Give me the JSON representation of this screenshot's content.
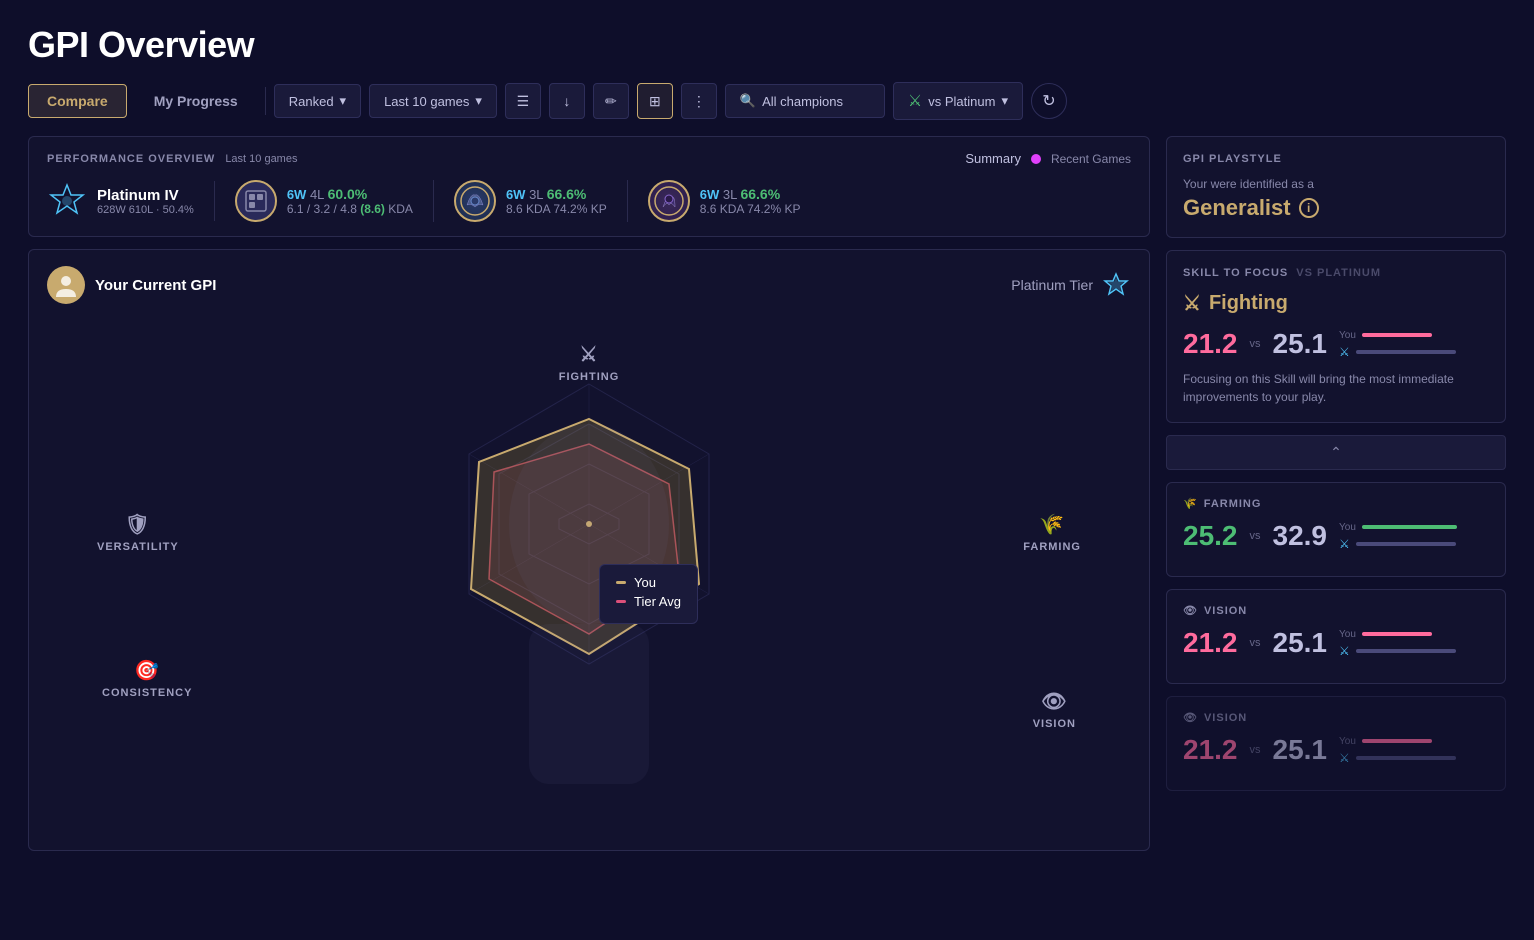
{
  "page": {
    "title": "GPI Overview"
  },
  "toolbar": {
    "compare_label": "Compare",
    "my_progress_label": "My Progress",
    "ranked_label": "Ranked",
    "last_10_label": "Last 10 games",
    "all_champions_label": "All champions",
    "vs_platinum_label": "vs Platinum"
  },
  "performance_overview": {
    "title": "PERFORMANCE OVERVIEW",
    "subtitle": "Last 10 games",
    "summary_label": "Summary",
    "recent_games_label": "Recent Games",
    "rank": {
      "name": "Platinum IV",
      "lp_info": "628W 610L · 50.4%"
    },
    "stat1": {
      "wins": "6W",
      "losses": "4L",
      "win_rate": "60.0%",
      "kda": "6.1 / 3.2 / 4.8",
      "kda_highlight": "(8.6)",
      "kda_label": "KDA"
    },
    "champ1": {
      "wins": "6W",
      "losses": "3L",
      "win_rate": "66.6%",
      "kda_val": "8.6",
      "kda_label": "KDA",
      "kp": "74.2%",
      "kp_label": "KP"
    },
    "champ2": {
      "wins": "6W",
      "losses": "3L",
      "win_rate": "66.6%",
      "kda_val": "8.6",
      "kda_label": "KDA",
      "kp": "74.2%",
      "kp_label": "KP"
    }
  },
  "chart": {
    "your_gpi_label": "Your Current GPI",
    "platinum_tier_label": "Platinum Tier",
    "labels": {
      "fighting": "FIGHTING",
      "farming": "FARMING",
      "vision": "VISION",
      "consistency": "CONSISTENCY",
      "versatility": "VERSATILITY"
    },
    "tooltip": {
      "you_label": "You",
      "tier_avg_label": "Tier Avg"
    }
  },
  "gpi_playstyle": {
    "title": "GPI PLAYSTYLE",
    "identified_as": "Your were identified as a",
    "type": "Generalist"
  },
  "skill_focus": {
    "title": "SKILL TO FOCUS",
    "subtitle": "vs Platinum",
    "skill_name": "Fighting",
    "score_you": "21.2",
    "score_vs": "vs",
    "score_avg": "25.1",
    "bar_you_label": "You",
    "bar_avg_icon": "⚔",
    "bar_you_width": 55,
    "bar_avg_width": 100,
    "description": "Focusing on this Skill will bring the most immediate improvements to your play."
  },
  "farming_card": {
    "title": "FARMING",
    "score_you": "25.2",
    "score_vs": "vs",
    "score_avg": "32.9",
    "bar_you_label": "You",
    "bar_you_width": 77,
    "bar_avg_width": 100
  },
  "vision_card": {
    "title": "VISION",
    "score_you": "21.2",
    "score_vs": "vs",
    "score_avg": "25.1",
    "bar_you_label": "You",
    "bar_you_width": 55,
    "bar_avg_width": 100
  },
  "vision_card2": {
    "title": "VISION",
    "score_you": "21.2",
    "score_vs": "vs",
    "score_avg": "25.1",
    "bar_you_label": "You",
    "bar_you_width": 55,
    "bar_avg_width": 100
  }
}
